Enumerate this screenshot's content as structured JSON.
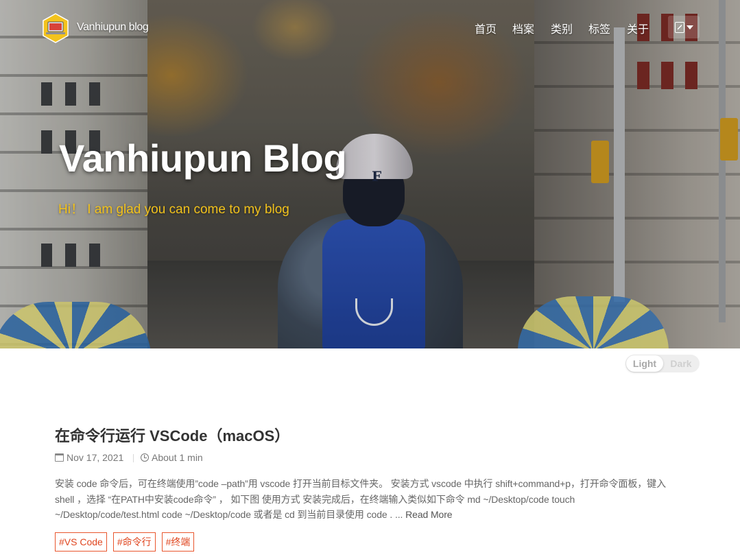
{
  "nav": {
    "brand": "Vanhiupun blog",
    "logo_icon": "laptop-hexagon-logo-icon",
    "items": [
      {
        "label": "首页"
      },
      {
        "label": "档案"
      },
      {
        "label": "类别"
      },
      {
        "label": "标签"
      },
      {
        "label": "关于"
      }
    ],
    "language_icon": "translate-icon"
  },
  "hero": {
    "title": "Vanhiupun Blog",
    "subtitle": "Hi！ I am glad you can come to my blog",
    "subtitle_color": "#f2c21c",
    "cap_letter": "F"
  },
  "theme_toggle": {
    "light_label": "Light",
    "dark_label": "Dark",
    "selected": "Light"
  },
  "post": {
    "title": "在命令行运行 VSCode（macOS）",
    "date": "Nov 17, 2021",
    "read_time": "About 1 min",
    "excerpt": "安装 code 命令后，可在终端使用”code –path”用 vscode 打开当前目标文件夹。 安装方式 vscode 中执行 shift+command+p，打开命令面板，键入 shell ，选择 “在PATH中安装code命令” ， 如下图 使用方式 安装完成后，在终端输入类似如下命令 md ~/Desktop/code touch ~/Desktop/code/test.html code ~/Desktop/code 或者是 cd 到当前目录使用 code . ...",
    "read_more": "Read More",
    "tags": [
      "#VS Code",
      "#命令行",
      "#终端"
    ],
    "tag_color": "#e9552c"
  }
}
